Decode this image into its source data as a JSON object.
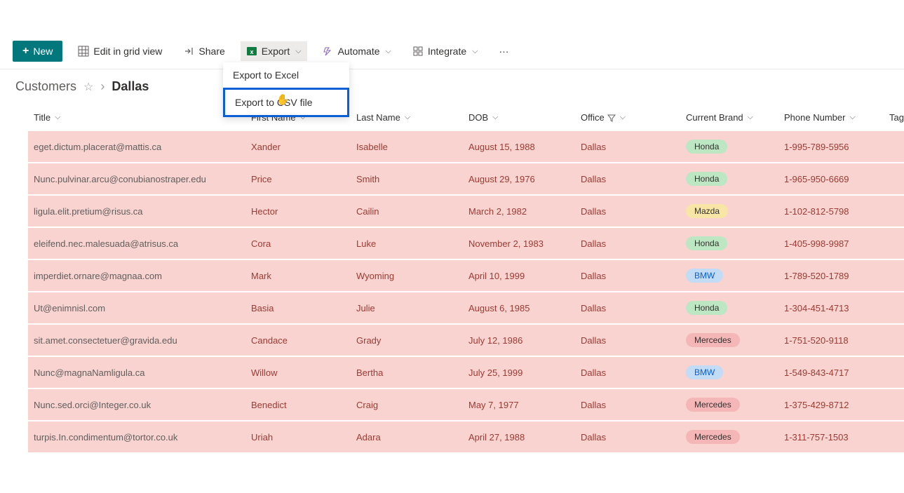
{
  "toolbar": {
    "new_label": "New",
    "edit_grid_label": "Edit in grid view",
    "share_label": "Share",
    "export_label": "Export",
    "automate_label": "Automate",
    "integrate_label": "Integrate"
  },
  "export_menu": {
    "excel": "Export to Excel",
    "csv": "Export to CSV file"
  },
  "breadcrumb": {
    "list": "Customers",
    "view": "Dallas"
  },
  "columns": {
    "title": "Title",
    "first_name": "First Name",
    "last_name": "Last Name",
    "dob": "DOB",
    "office": "Office",
    "current_brand": "Current Brand",
    "phone": "Phone Number",
    "tags": "Tags"
  },
  "rows": [
    {
      "title": "eget.dictum.placerat@mattis.ca",
      "first_name": "Xander",
      "last_name": "Isabelle",
      "dob": "August 15, 1988",
      "office": "Dallas",
      "brand": "Honda",
      "phone": "1-995-789-5956"
    },
    {
      "title": "Nunc.pulvinar.arcu@conubianostraper.edu",
      "first_name": "Price",
      "last_name": "Smith",
      "dob": "August 29, 1976",
      "office": "Dallas",
      "brand": "Honda",
      "phone": "1-965-950-6669"
    },
    {
      "title": "ligula.elit.pretium@risus.ca",
      "first_name": "Hector",
      "last_name": "Cailin",
      "dob": "March 2, 1982",
      "office": "Dallas",
      "brand": "Mazda",
      "phone": "1-102-812-5798"
    },
    {
      "title": "eleifend.nec.malesuada@atrisus.ca",
      "first_name": "Cora",
      "last_name": "Luke",
      "dob": "November 2, 1983",
      "office": "Dallas",
      "brand": "Honda",
      "phone": "1-405-998-9987"
    },
    {
      "title": "imperdiet.ornare@magnaa.com",
      "first_name": "Mark",
      "last_name": "Wyoming",
      "dob": "April 10, 1999",
      "office": "Dallas",
      "brand": "BMW",
      "phone": "1-789-520-1789"
    },
    {
      "title": "Ut@enimnisl.com",
      "first_name": "Basia",
      "last_name": "Julie",
      "dob": "August 6, 1985",
      "office": "Dallas",
      "brand": "Honda",
      "phone": "1-304-451-4713"
    },
    {
      "title": "sit.amet.consectetuer@gravida.edu",
      "first_name": "Candace",
      "last_name": "Grady",
      "dob": "July 12, 1986",
      "office": "Dallas",
      "brand": "Mercedes",
      "phone": "1-751-520-9118"
    },
    {
      "title": "Nunc@magnaNamligula.ca",
      "first_name": "Willow",
      "last_name": "Bertha",
      "dob": "July 25, 1999",
      "office": "Dallas",
      "brand": "BMW",
      "phone": "1-549-843-4717"
    },
    {
      "title": "Nunc.sed.orci@Integer.co.uk",
      "first_name": "Benedict",
      "last_name": "Craig",
      "dob": "May 7, 1977",
      "office": "Dallas",
      "brand": "Mercedes",
      "phone": "1-375-429-8712"
    },
    {
      "title": "turpis.In.condimentum@tortor.co.uk",
      "first_name": "Uriah",
      "last_name": "Adara",
      "dob": "April 27, 1988",
      "office": "Dallas",
      "brand": "Mercedes",
      "phone": "1-311-757-1503"
    }
  ]
}
